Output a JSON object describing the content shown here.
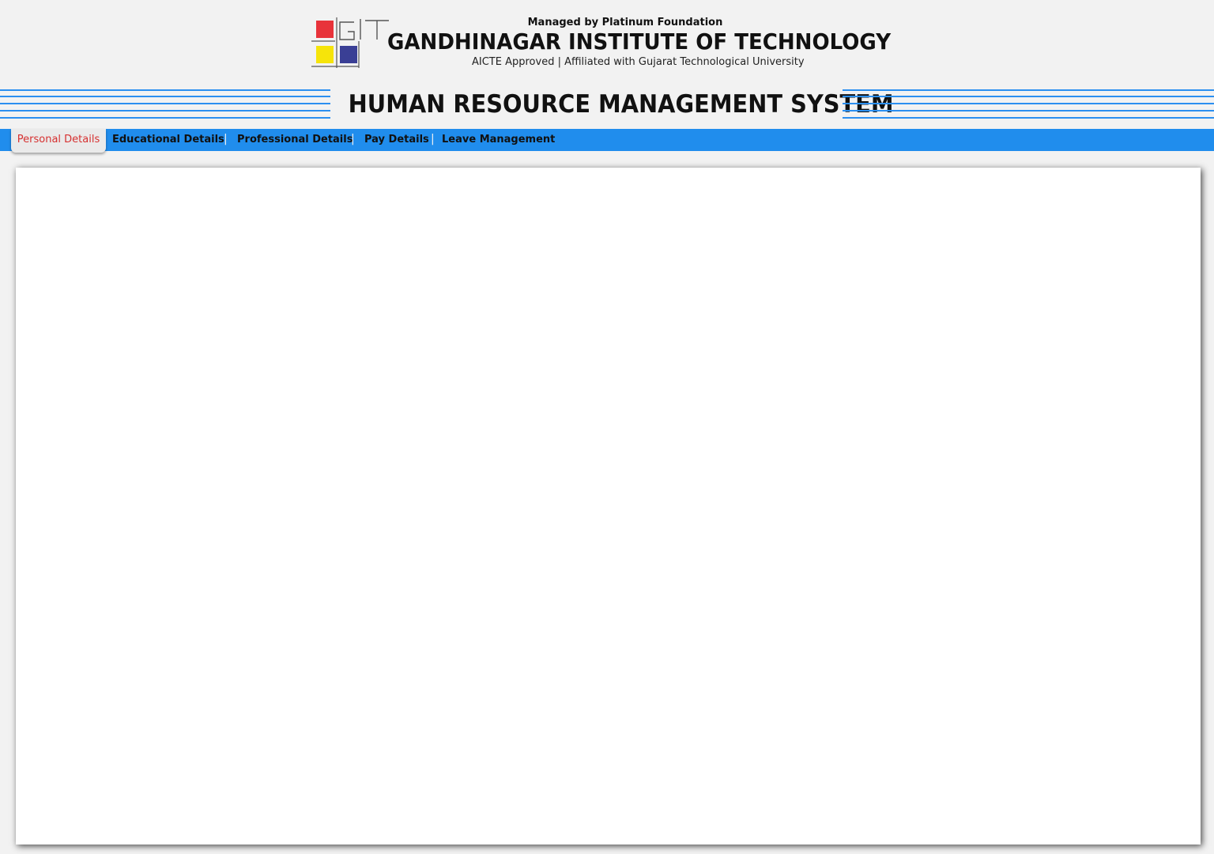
{
  "header": {
    "logo_text": "GIT",
    "managed_by": "Managed by Platinum Foundation",
    "institute_name": "GANDHINAGAR INSTITUTE OF TECHNOLOGY",
    "affiliation": "AICTE Approved | Affiliated with Gujarat Technological University"
  },
  "system_title": "HUMAN RESOURCE MANAGEMENT SYSTEM",
  "nav": {
    "items": [
      {
        "label": "Personal Details",
        "active": true
      },
      {
        "label": "Educational Details"
      },
      {
        "label": "Professional Details"
      },
      {
        "label": "Pay Details"
      },
      {
        "label": "Leave Management"
      }
    ],
    "separator": "|"
  },
  "colors": {
    "nav_background": "#208ded",
    "title_lines": "#2b8ff0",
    "active_tab_text": "#d63030",
    "logo_red": "#e8333a",
    "logo_yellow": "#f6e40a",
    "logo_blue": "#3a3f95"
  }
}
